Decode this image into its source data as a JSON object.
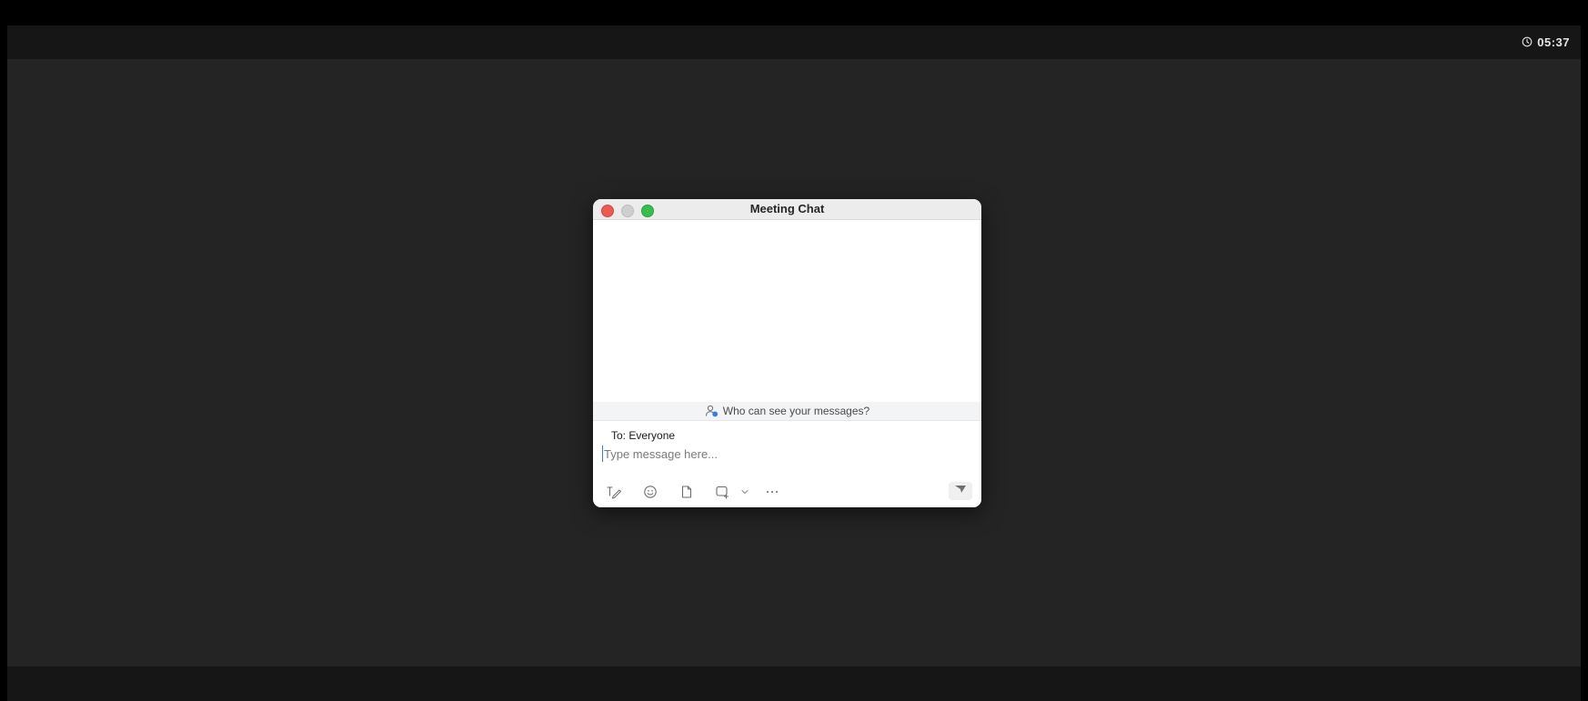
{
  "timer": {
    "icon": "clock-icon",
    "value": "05:37"
  },
  "chat": {
    "title": "Meeting Chat",
    "visibility_notice": "Who can see your messages?",
    "to_label": "To: Everyone",
    "input_placeholder": "Type message here...",
    "input_value": "",
    "toolbar_icons": [
      "format-icon",
      "emoji-icon",
      "file-icon",
      "screenshot-icon",
      "chevron-down-icon",
      "more-icon",
      "send-icon"
    ],
    "colors": {
      "close": "#ee5a52",
      "minimize": "#cfcfcf",
      "maximize": "#35c04a",
      "accent": "#2f7cf6"
    }
  }
}
